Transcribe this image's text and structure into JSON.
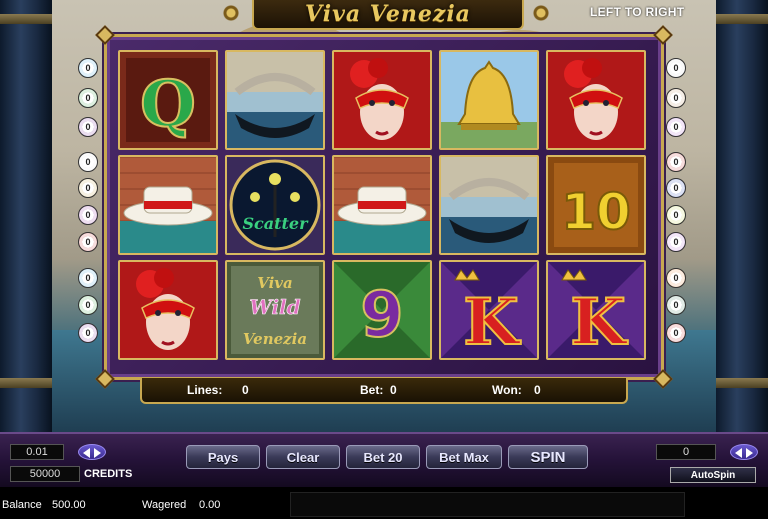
{
  "game": {
    "title": "Viva Venezia",
    "direction": "LEFT TO RIGHT"
  },
  "paylines_left": [
    {
      "label": "0",
      "color": "#3aa0d8"
    },
    {
      "label": "0",
      "color": "#2a9a3a"
    },
    {
      "label": "0",
      "color": "#7a2a9a"
    },
    {
      "label": "0",
      "color": "#e0e0e0"
    },
    {
      "label": "0",
      "color": "#c0a040"
    },
    {
      "label": "0",
      "color": "#8a2a9a"
    },
    {
      "label": "0",
      "color": "#c02020"
    },
    {
      "label": "0",
      "color": "#3aa0d8"
    },
    {
      "label": "0",
      "color": "#2a9a3a"
    },
    {
      "label": "0",
      "color": "#7a2a9a"
    }
  ],
  "paylines_right": [
    {
      "label": "0",
      "color": "#d8d8d8"
    },
    {
      "label": "0",
      "color": "#b89060"
    },
    {
      "label": "0",
      "color": "#b060d0"
    },
    {
      "label": "0",
      "color": "#c02020"
    },
    {
      "label": "0",
      "color": "#2040b0"
    },
    {
      "label": "0",
      "color": "#c0d040"
    },
    {
      "label": "0",
      "color": "#b060d0"
    },
    {
      "label": "0",
      "color": "#e08030"
    },
    {
      "label": "0",
      "color": "#3a7a5a"
    },
    {
      "label": "0",
      "color": "#c02020"
    }
  ],
  "reels": [
    [
      "queen-symbol",
      "gondola-symbol",
      "mask-symbol",
      "bell-symbol",
      "mask-symbol"
    ],
    [
      "hat-symbol",
      "lamp-scatter-symbol",
      "hat-symbol",
      "gondola-symbol",
      "ten-symbol"
    ],
    [
      "mask-symbol",
      "wild-symbol",
      "nine-symbol",
      "king-symbol",
      "king-symbol"
    ]
  ],
  "symbol_text": {
    "queen": "Q",
    "ten": "10",
    "nine": "9",
    "king": "K",
    "scatter": "Scatter",
    "wild_top": "Viva",
    "wild_mid": "Wild",
    "wild_bot": "Venezia"
  },
  "info": {
    "lines_label": "Lines:",
    "lines_value": "0",
    "bet_label": "Bet:",
    "bet_value": "0",
    "won_label": "Won:",
    "won_value": "0"
  },
  "controls": {
    "coin_value": "0.01",
    "credits_value": "50000",
    "credits_label": "CREDITS",
    "right_display": "0",
    "pays": "Pays",
    "clear": "Clear",
    "bet20": "Bet 20",
    "betmax": "Bet Max",
    "spin": "SPIN",
    "autospin": "AutoSpin"
  },
  "status": {
    "balance_label": "Balance",
    "balance_value": "500.00",
    "wagered_label": "Wagered",
    "wagered_value": "0.00"
  }
}
